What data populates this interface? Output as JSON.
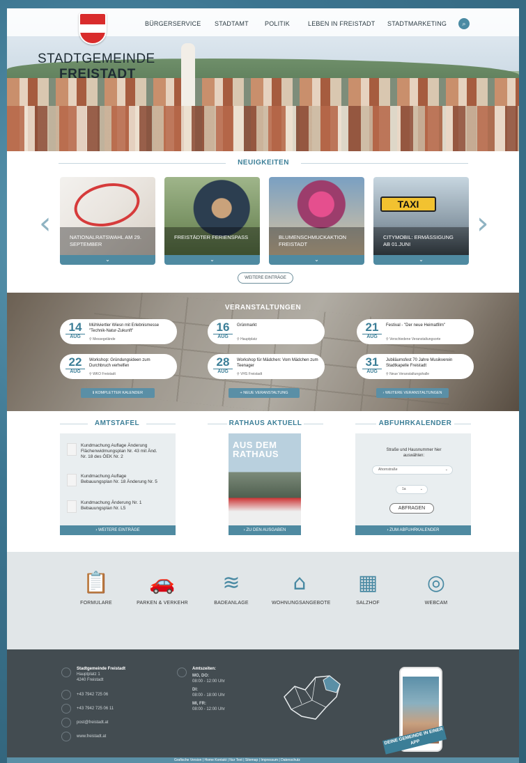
{
  "nav": {
    "items": [
      "BÜRGERSERVICE",
      "STADTAMT",
      "POLITIK",
      "LEBEN IN FREISTADT",
      "STADTMARKETING"
    ]
  },
  "brand": {
    "line1": "STADTGEMEINDE",
    "line2": "FREISTADT"
  },
  "news": {
    "title": "NEUIGKEITEN",
    "items": [
      {
        "caption": "NATIONALRATSWAHL AM 29. SEPTEMBER"
      },
      {
        "caption": "FREISTÄDTER FERIENSPASS"
      },
      {
        "caption": "BLUMENSCHMUCKAKTION FREISTADT"
      },
      {
        "caption": "CITYMOBIL: ERMÄSSIGUNG AB 01.JUNI"
      }
    ],
    "more_label": "WEITERE EINTRÄGE"
  },
  "events": {
    "title": "VERANSTALTUNGEN",
    "items": [
      {
        "day": "14",
        "month": "AUG",
        "title": "Mühlviertler Wiesn mit Erlebnismesse \"Technik-Natur-Zukunft\"",
        "loc": "Messegelände"
      },
      {
        "day": "16",
        "month": "AUG",
        "title": "Grünmarkt",
        "loc": "Hauptplatz"
      },
      {
        "day": "21",
        "month": "AUG",
        "title": "Festival - \"Der neue Heimatfilm\"",
        "loc": "Verschiedene Veranstaltungsorte"
      },
      {
        "day": "22",
        "month": "AUG",
        "title": "Workshop: Gründungsideen zum Durchbruch verhelfen",
        "loc": "WKO Freistadt"
      },
      {
        "day": "28",
        "month": "AUG",
        "title": "Workshop für Mädchen: Vom Mädchen zum Teenager",
        "loc": "VHS Freistadt"
      },
      {
        "day": "31",
        "month": "AUG",
        "title": "Jubiläumsfest 70 Jahre Musikverein Stadtkapelle Freistadt",
        "loc": "Neue Veranstaltungshalle"
      }
    ],
    "buttons": [
      "KOMPLETTER KALENDER",
      "NEUE VERANSTALTUNG",
      "WEITERE VERANSTALTUNGEN"
    ]
  },
  "amtstafel": {
    "title": "AMTSTAFEL",
    "items": [
      "Kundmachung Auflage Änderung Flächenwidmungsplan Nr. 43 mit Änd. Nr. 18 des ÖEK Nr. 2",
      "Kundmachung Auflage Bebauungsplan Nr. 18 Änderung Nr. 5",
      "Kundmachung Änderung Nr. 1 Bebauungsplan Nr. L5"
    ],
    "more": "WEITERE EINTRÄGE"
  },
  "rathaus": {
    "title": "RATHAUS AKTUELL",
    "mag_title_1": "AUS DEM",
    "mag_title_2": "RATHAUS",
    "more": "ZU DEN AUSGABEN"
  },
  "abfuhr": {
    "title": "ABFUHRKALENDER",
    "text": "Straße und Hausnummer hier auswählen:",
    "street": "Ahornstraße",
    "number": "1a",
    "button": "ABFRAGEN",
    "more": "ZUM ABFUHRKALENDER"
  },
  "quick": [
    {
      "icon": "form-icon",
      "glyph": "📋",
      "label": "FORMULARE"
    },
    {
      "icon": "parking-icon",
      "glyph": "🚗",
      "label": "PARKEN & VERKEHR"
    },
    {
      "icon": "bath-icon",
      "glyph": "≋",
      "label": "BADEANLAGE"
    },
    {
      "icon": "house-icon",
      "glyph": "⌂",
      "label": "WOHNUNGSANGEBOTE"
    },
    {
      "icon": "calendar-icon",
      "glyph": "▦",
      "label": "SALZHOF"
    },
    {
      "icon": "webcam-icon",
      "glyph": "◎",
      "label": "WEBCAM"
    }
  ],
  "footer": {
    "name": "Stadtgemeinde Freistadt",
    "street": "Hauptplatz 1",
    "city": "4240 Freistadt",
    "phone": "+43 7942 725 06",
    "fax": "+43 7942 725 06 11",
    "email": "post@freistadt.at",
    "web": "www.freistadt.at",
    "hours_title": "Amtszeiten:",
    "hours1_d": "MO, DO:",
    "hours1": "08:00 - 12:00 Uhr",
    "hours2_d": "DI:",
    "hours2": "08:00 - 18:00 Uhr",
    "hours3_d": "MI, FR:",
    "hours3": "08:00 - 12:00 Uhr",
    "ribbon": "DEINE GEMEINDE IN EINER APP",
    "links": "Grafische Version  |  Home Kontakt  |  Nur Text  |  Sitemap  |  Impressum  |  Datenschutz"
  },
  "colors": {
    "accent": "#4f8aa1",
    "dark": "#434c51"
  }
}
